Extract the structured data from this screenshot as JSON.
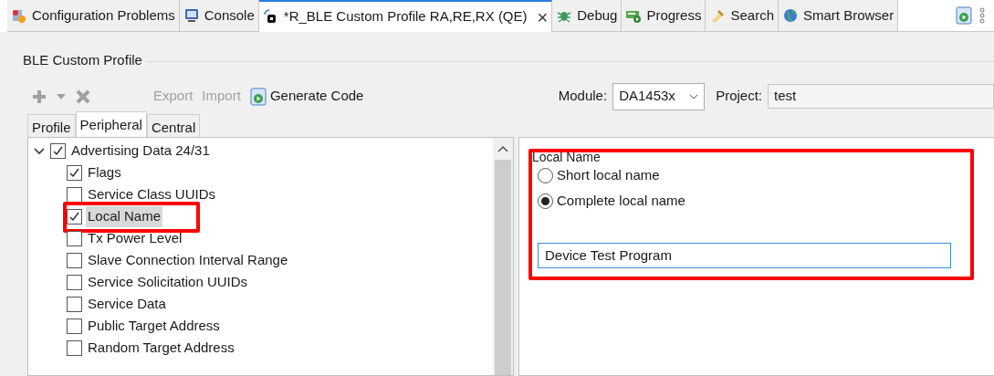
{
  "editor_tabs": [
    {
      "label": "Configuration Problems",
      "selected": false,
      "closable": false
    },
    {
      "label": "Console",
      "selected": false,
      "closable": false
    },
    {
      "label": "*R_BLE Custom Profile RA,RE,RX (QE)",
      "selected": true,
      "closable": true
    },
    {
      "label": "Debug",
      "selected": false,
      "closable": false
    },
    {
      "label": "Progress",
      "selected": false,
      "closable": false
    },
    {
      "label": "Search",
      "selected": false,
      "closable": false
    },
    {
      "label": "Smart Browser",
      "selected": false,
      "closable": false
    }
  ],
  "close_glyph": "×",
  "group_title": "BLE Custom Profile",
  "toolbar": [
    {
      "kind": "icon",
      "disabled": true
    },
    {
      "kind": "icon",
      "disabled": true
    },
    {
      "kind": "icon",
      "disabled": true
    },
    {
      "kind": "text",
      "label": "Export",
      "disabled": true
    },
    {
      "kind": "text",
      "label": "Import",
      "disabled": true
    },
    {
      "kind": "icon_text",
      "label": "Generate Code",
      "disabled": false
    }
  ],
  "module": {
    "label": "Module:",
    "value": "DA1453x"
  },
  "project": {
    "label": "Project:",
    "value": "test"
  },
  "sub_tabs": [
    {
      "label": "Profile",
      "selected": false
    },
    {
      "label": "Peripheral",
      "selected": true
    },
    {
      "label": "Central",
      "selected": false
    }
  ],
  "tree": [
    {
      "label": "Advertising Data 24/31",
      "checked": true,
      "expanded": true,
      "children": [
        {
          "label": "Flags",
          "checked": true,
          "selected": false,
          "highlighted": false
        },
        {
          "label": "Service Class UUIDs",
          "checked": false,
          "selected": false,
          "highlighted": false
        },
        {
          "label": "Local Name",
          "checked": true,
          "selected": true,
          "highlighted": true
        },
        {
          "label": "Tx Power Level",
          "checked": false,
          "selected": false,
          "highlighted": false
        },
        {
          "label": "Slave Connection Interval Range",
          "checked": false,
          "selected": false,
          "highlighted": false
        },
        {
          "label": "Service Solicitation UUIDs",
          "checked": false,
          "selected": false,
          "highlighted": false
        },
        {
          "label": "Service Data",
          "checked": false,
          "selected": false,
          "highlighted": false
        },
        {
          "label": "Public Target Address",
          "checked": false,
          "selected": false,
          "highlighted": false
        },
        {
          "label": "Random Target Address",
          "checked": false,
          "selected": false,
          "highlighted": false
        }
      ]
    }
  ],
  "local_name": {
    "title": "Local Name",
    "highlighted": true,
    "options": [
      {
        "label": "Short local name",
        "selected": false
      },
      {
        "label": "Complete local name",
        "selected": true
      }
    ],
    "value": "Device Test Program"
  }
}
